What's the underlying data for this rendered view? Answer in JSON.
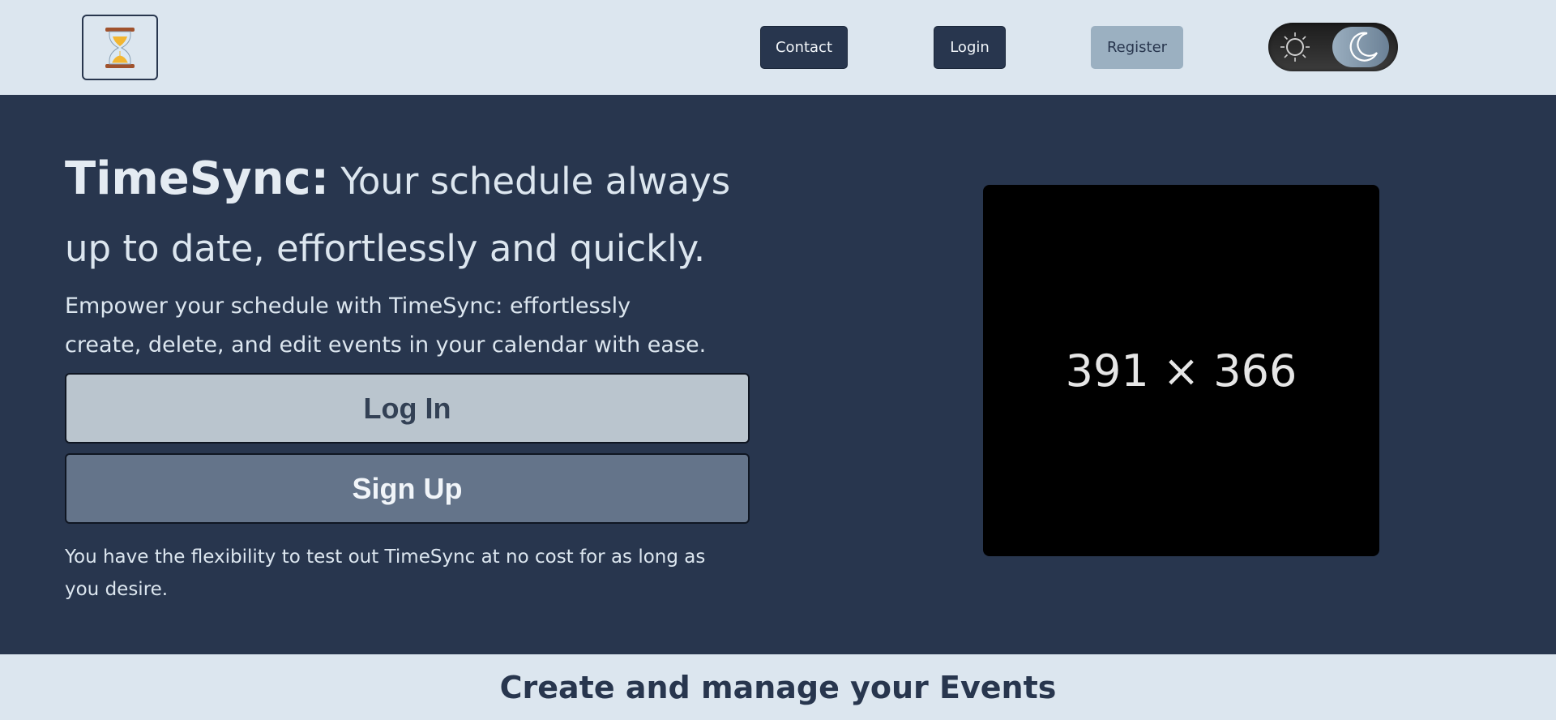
{
  "header": {
    "logo_glyph": "⌛",
    "nav": {
      "contact_label": "Contact",
      "login_label": "Login",
      "register_label": "Register"
    },
    "theme_toggle": {
      "light_icon": "sun-icon",
      "dark_icon": "moon-icon",
      "active": "dark"
    }
  },
  "hero": {
    "brand": "TimeSync:",
    "headline": " Your schedule always up to date, effortlessly and quickly.",
    "description": "Empower your schedule with TimeSync: effortlessly create, delete, and edit events in your calendar with ease.",
    "login_button": "Log In",
    "signup_button": "Sign Up",
    "note": "You have the flexibility to test out TimeSync at no cost for as long as you desire.",
    "image_placeholder": "391 × 366"
  },
  "section": {
    "title": "Create and manage your Events"
  },
  "colors": {
    "header_bg": "#dce6ef",
    "hero_bg": "#28364e",
    "primary_dark": "#28364e",
    "register_bg": "#9bb0c1",
    "login_cta_bg": "#bac5ce",
    "signup_cta_bg": "#64748a"
  }
}
